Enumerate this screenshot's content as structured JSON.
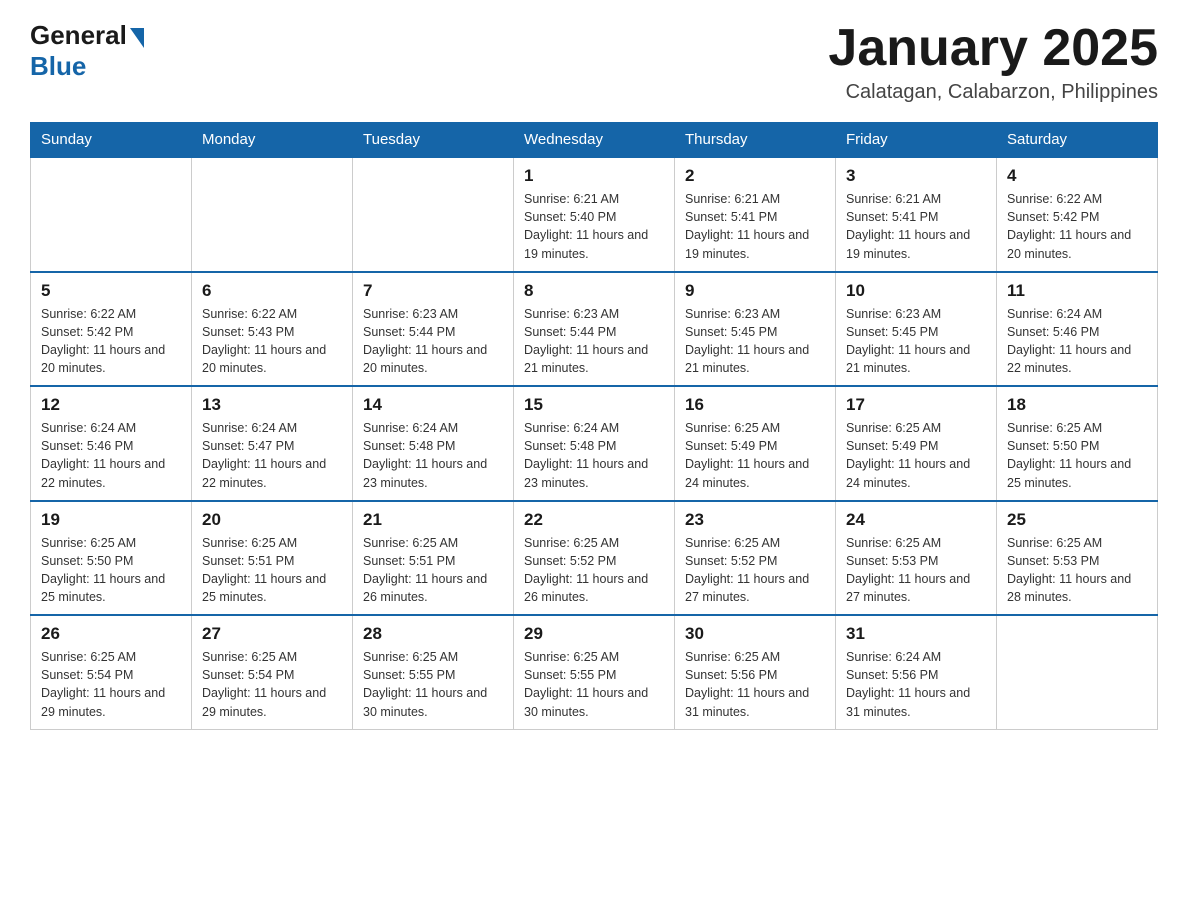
{
  "header": {
    "logo_general": "General",
    "logo_blue": "Blue",
    "month_title": "January 2025",
    "location": "Calatagan, Calabarzon, Philippines"
  },
  "days_of_week": [
    "Sunday",
    "Monday",
    "Tuesday",
    "Wednesday",
    "Thursday",
    "Friday",
    "Saturday"
  ],
  "weeks": [
    [
      null,
      null,
      null,
      {
        "day": "1",
        "sunrise": "6:21 AM",
        "sunset": "5:40 PM",
        "daylight": "11 hours and 19 minutes."
      },
      {
        "day": "2",
        "sunrise": "6:21 AM",
        "sunset": "5:41 PM",
        "daylight": "11 hours and 19 minutes."
      },
      {
        "day": "3",
        "sunrise": "6:21 AM",
        "sunset": "5:41 PM",
        "daylight": "11 hours and 19 minutes."
      },
      {
        "day": "4",
        "sunrise": "6:22 AM",
        "sunset": "5:42 PM",
        "daylight": "11 hours and 20 minutes."
      }
    ],
    [
      {
        "day": "5",
        "sunrise": "6:22 AM",
        "sunset": "5:42 PM",
        "daylight": "11 hours and 20 minutes."
      },
      {
        "day": "6",
        "sunrise": "6:22 AM",
        "sunset": "5:43 PM",
        "daylight": "11 hours and 20 minutes."
      },
      {
        "day": "7",
        "sunrise": "6:23 AM",
        "sunset": "5:44 PM",
        "daylight": "11 hours and 20 minutes."
      },
      {
        "day": "8",
        "sunrise": "6:23 AM",
        "sunset": "5:44 PM",
        "daylight": "11 hours and 21 minutes."
      },
      {
        "day": "9",
        "sunrise": "6:23 AM",
        "sunset": "5:45 PM",
        "daylight": "11 hours and 21 minutes."
      },
      {
        "day": "10",
        "sunrise": "6:23 AM",
        "sunset": "5:45 PM",
        "daylight": "11 hours and 21 minutes."
      },
      {
        "day": "11",
        "sunrise": "6:24 AM",
        "sunset": "5:46 PM",
        "daylight": "11 hours and 22 minutes."
      }
    ],
    [
      {
        "day": "12",
        "sunrise": "6:24 AM",
        "sunset": "5:46 PM",
        "daylight": "11 hours and 22 minutes."
      },
      {
        "day": "13",
        "sunrise": "6:24 AM",
        "sunset": "5:47 PM",
        "daylight": "11 hours and 22 minutes."
      },
      {
        "day": "14",
        "sunrise": "6:24 AM",
        "sunset": "5:48 PM",
        "daylight": "11 hours and 23 minutes."
      },
      {
        "day": "15",
        "sunrise": "6:24 AM",
        "sunset": "5:48 PM",
        "daylight": "11 hours and 23 minutes."
      },
      {
        "day": "16",
        "sunrise": "6:25 AM",
        "sunset": "5:49 PM",
        "daylight": "11 hours and 24 minutes."
      },
      {
        "day": "17",
        "sunrise": "6:25 AM",
        "sunset": "5:49 PM",
        "daylight": "11 hours and 24 minutes."
      },
      {
        "day": "18",
        "sunrise": "6:25 AM",
        "sunset": "5:50 PM",
        "daylight": "11 hours and 25 minutes."
      }
    ],
    [
      {
        "day": "19",
        "sunrise": "6:25 AM",
        "sunset": "5:50 PM",
        "daylight": "11 hours and 25 minutes."
      },
      {
        "day": "20",
        "sunrise": "6:25 AM",
        "sunset": "5:51 PM",
        "daylight": "11 hours and 25 minutes."
      },
      {
        "day": "21",
        "sunrise": "6:25 AM",
        "sunset": "5:51 PM",
        "daylight": "11 hours and 26 minutes."
      },
      {
        "day": "22",
        "sunrise": "6:25 AM",
        "sunset": "5:52 PM",
        "daylight": "11 hours and 26 minutes."
      },
      {
        "day": "23",
        "sunrise": "6:25 AM",
        "sunset": "5:52 PM",
        "daylight": "11 hours and 27 minutes."
      },
      {
        "day": "24",
        "sunrise": "6:25 AM",
        "sunset": "5:53 PM",
        "daylight": "11 hours and 27 minutes."
      },
      {
        "day": "25",
        "sunrise": "6:25 AM",
        "sunset": "5:53 PM",
        "daylight": "11 hours and 28 minutes."
      }
    ],
    [
      {
        "day": "26",
        "sunrise": "6:25 AM",
        "sunset": "5:54 PM",
        "daylight": "11 hours and 29 minutes."
      },
      {
        "day": "27",
        "sunrise": "6:25 AM",
        "sunset": "5:54 PM",
        "daylight": "11 hours and 29 minutes."
      },
      {
        "day": "28",
        "sunrise": "6:25 AM",
        "sunset": "5:55 PM",
        "daylight": "11 hours and 30 minutes."
      },
      {
        "day": "29",
        "sunrise": "6:25 AM",
        "sunset": "5:55 PM",
        "daylight": "11 hours and 30 minutes."
      },
      {
        "day": "30",
        "sunrise": "6:25 AM",
        "sunset": "5:56 PM",
        "daylight": "11 hours and 31 minutes."
      },
      {
        "day": "31",
        "sunrise": "6:24 AM",
        "sunset": "5:56 PM",
        "daylight": "11 hours and 31 minutes."
      },
      null
    ]
  ]
}
